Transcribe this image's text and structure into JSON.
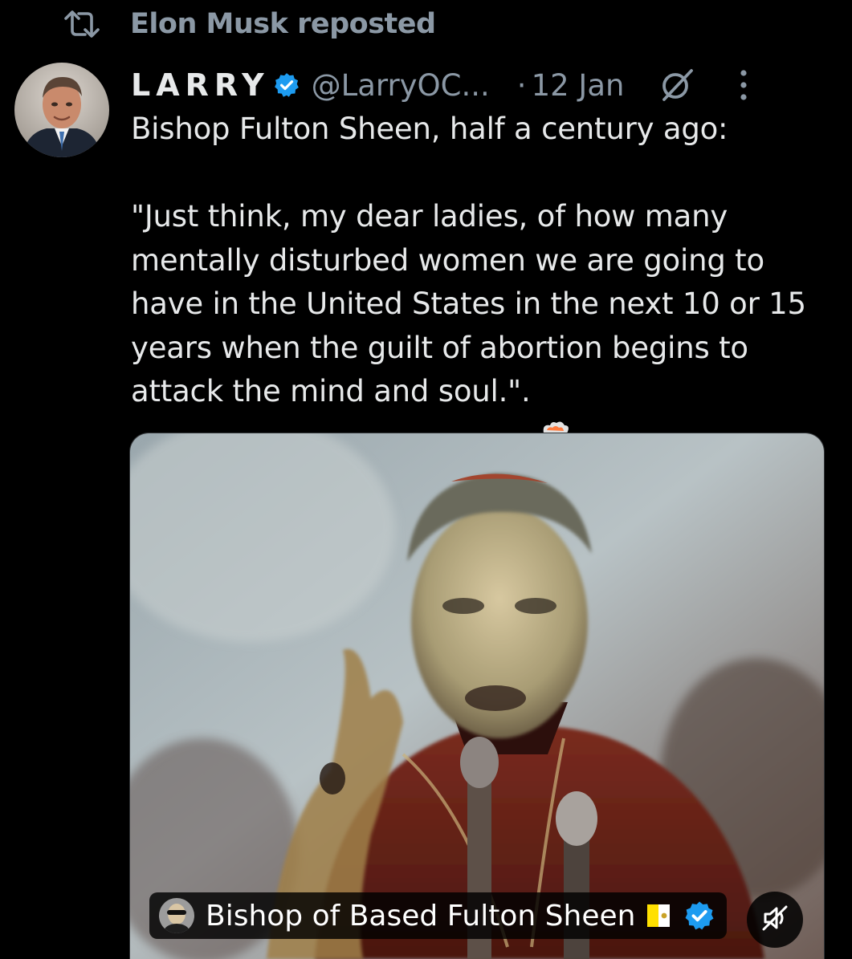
{
  "repost": {
    "icon": "repost-icon",
    "label": "Elon Musk reposted"
  },
  "tweet": {
    "author": {
      "display_name": "LARRY",
      "handle": "@LarryOC...",
      "verified_icon": "verified-badge-icon"
    },
    "separator": "·",
    "date": "12 Jan",
    "text": "Bishop Fulton Sheen, half a century ago:\n\n\"Just think, my dear ladies, of how many mentally disturbed women we are going to have in the United States in the next 10 or 15 years when the guilt of abortion begins to attack the mind and soul.\".",
    "emoji": "exploding-head-emoji"
  },
  "media": {
    "type": "video",
    "caption_account": "Bishop of Based Fulton Sheen",
    "caption_flag_icon": "vatican-flag-icon",
    "mute_icon": "muted-speaker-icon"
  },
  "colors": {
    "background": "#000000",
    "text": "#e7e9ea",
    "secondary": "#8b98a5",
    "verified_blue": "#1d9bf0"
  }
}
